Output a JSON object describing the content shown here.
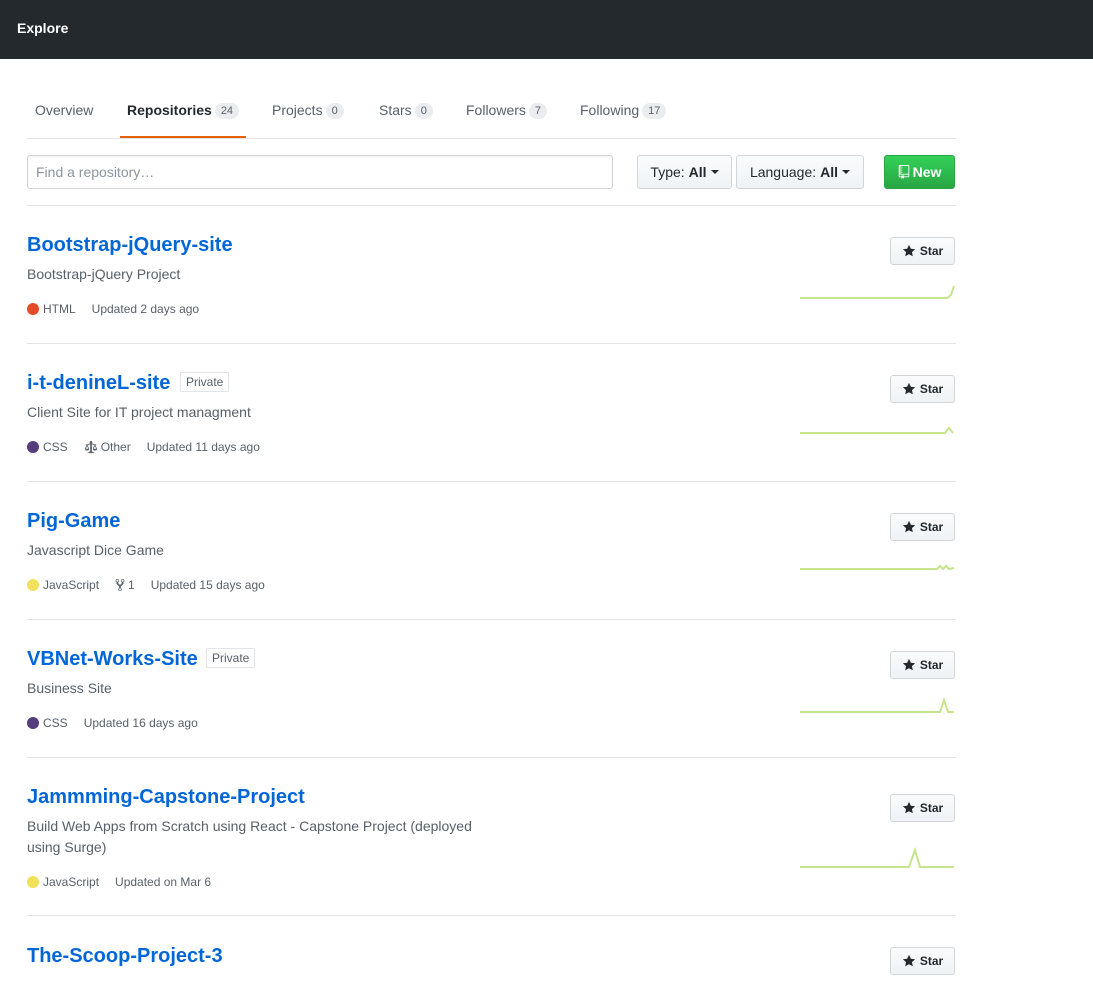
{
  "header": {
    "title": "Explore"
  },
  "tabs": [
    {
      "label": "Overview",
      "count": ""
    },
    {
      "label": "Repositories",
      "count": "24"
    },
    {
      "label": "Projects",
      "count": "0"
    },
    {
      "label": "Stars",
      "count": "0"
    },
    {
      "label": "Followers",
      "count": "7"
    },
    {
      "label": "Following",
      "count": "17"
    }
  ],
  "filters": {
    "search_placeholder": "Find a repository…",
    "type_label": "Type:",
    "type_value": "All",
    "language_label": "Language:",
    "language_value": "All",
    "new_label": "New"
  },
  "star_label": "Star",
  "colors": {
    "html": "#e34c26",
    "css": "#563d7c",
    "javascript": "#f1e05a",
    "accent": "#e36209",
    "link": "#0366d6",
    "new_button": "#28a745",
    "sparkline": "#c6e48b"
  },
  "repos": [
    {
      "name": "Bootstrap-jQuery-site",
      "private": "",
      "description": "Bootstrap-jQuery Project",
      "language": "HTML",
      "license": "",
      "forks": "",
      "updated": "Updated 2 days ago",
      "sparkline_icon": "activity-sparkline"
    },
    {
      "name": "i-t-denineL-site",
      "private": "Private",
      "description": "Client Site for IT project managment",
      "language": "CSS",
      "license": "Other",
      "forks": "",
      "updated": "Updated 11 days ago",
      "sparkline_icon": "activity-sparkline"
    },
    {
      "name": "Pig-Game",
      "private": "",
      "description": "Javascript Dice Game",
      "language": "JavaScript",
      "license": "",
      "forks": "1",
      "updated": "Updated 15 days ago",
      "sparkline_icon": "activity-sparkline"
    },
    {
      "name": "VBNet-Works-Site",
      "private": "Private",
      "description": "Business Site",
      "language": "CSS",
      "license": "",
      "forks": "",
      "updated": "Updated 16 days ago",
      "sparkline_icon": "activity-sparkline"
    },
    {
      "name": "Jammming-Capstone-Project",
      "private": "",
      "description": "Build Web Apps from Scratch using React - Capstone Project (deployed using Surge)",
      "language": "JavaScript",
      "license": "",
      "forks": "",
      "updated": "Updated on Mar 6",
      "sparkline_icon": "activity-sparkline"
    },
    {
      "name": "The-Scoop-Project-3",
      "private": "",
      "description": "",
      "language": "",
      "license": "",
      "forks": "",
      "updated": "",
      "sparkline_icon": ""
    }
  ]
}
